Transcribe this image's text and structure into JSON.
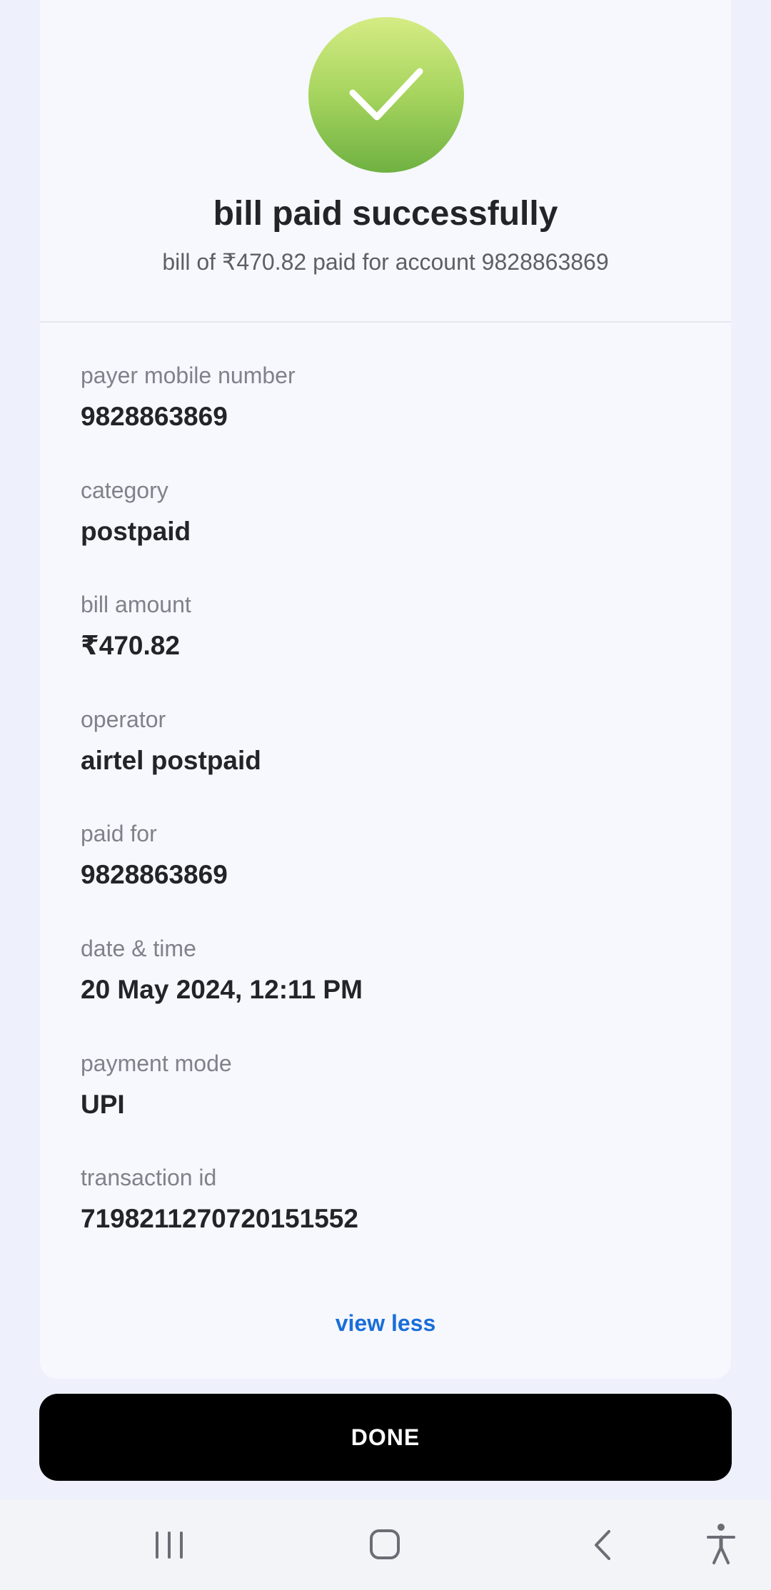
{
  "receipt": {
    "title": "bill paid successfully",
    "subtitle": "bill of ₹470.82 paid for account 9828863869",
    "details": [
      {
        "label": "payer mobile number",
        "value": "9828863869"
      },
      {
        "label": "category",
        "value": "postpaid"
      },
      {
        "label": "bill amount",
        "value": "₹470.82"
      },
      {
        "label": "operator",
        "value": "airtel postpaid"
      },
      {
        "label": "paid for",
        "value": "9828863869"
      },
      {
        "label": "date & time",
        "value": "20 May 2024, 12:11 PM"
      },
      {
        "label": "payment mode",
        "value": "UPI"
      },
      {
        "label": "transaction id",
        "value": "719821127072015155 2"
      }
    ],
    "toggle_label": "view less"
  },
  "actions": {
    "done_label": "DONE"
  },
  "icons": {
    "success": "checkmark-icon",
    "nav_recents": "recent-apps-icon",
    "nav_home": "home-icon",
    "nav_back": "back-icon",
    "nav_accessibility": "accessibility-icon"
  },
  "colors": {
    "accent_link": "#1a6ed8",
    "success_green": "#8cc552",
    "button_bg": "#000000"
  }
}
